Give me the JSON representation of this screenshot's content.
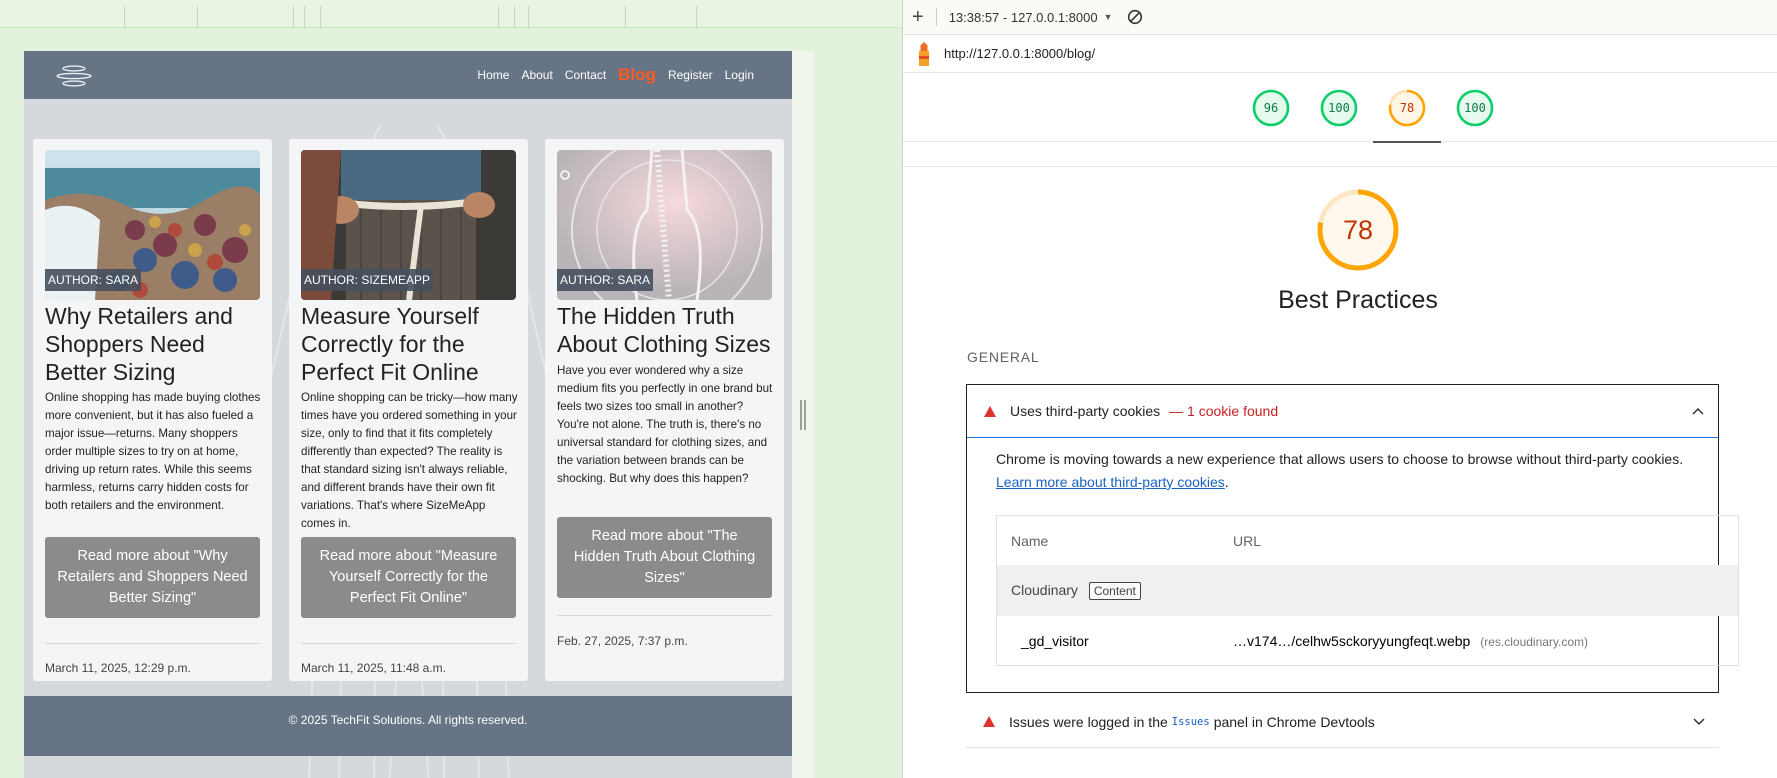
{
  "colors": {
    "pass": "#0cce6b",
    "average": "#ffa400",
    "average_text": "#c33300",
    "fail": "#e03131",
    "nav_bg": "#667486",
    "nav_active": "#ff5a1f",
    "button_bg": "#8b8b8b"
  },
  "site": {
    "logo_icon": "hamburger-ellipse-logo",
    "nav": {
      "home": "Home",
      "about": "About",
      "contact": "Contact",
      "blog": "Blog",
      "register": "Register",
      "login": "Login"
    },
    "posts": [
      {
        "author": "AUTHOR: SARA",
        "title": "Why Retailers and Shoppers Need Better Sizing",
        "excerpt": "Online shopping has made buying clothes more convenient, but it has also fueled a major issue—returns. Many shoppers order multiple sizes to try on at home, driving up return rates. While this seems harmless, returns carry hidden costs for both retailers and the environment.",
        "button": "Read more about \"Why Retailers and Shoppers Need Better Sizing\"",
        "date": "March 11, 2025, 12:29 p.m."
      },
      {
        "author": "AUTHOR: SIZEMEAPP",
        "title": "Measure Yourself Correctly for the Perfect Fit Online",
        "excerpt": "Online shopping can be tricky—how many times have you ordered something in your size, only to find that it fits completely differently than expected? The reality is that standard sizing isn't always reliable, and different brands have their own fit variations. That's where SizeMeApp comes in.",
        "button": "Read more about \"Measure Yourself Correctly for the Perfect Fit Online\"",
        "date": "March 11, 2025, 11:48 a.m."
      },
      {
        "author": "AUTHOR: SARA",
        "title": "The Hidden Truth About Clothing Sizes",
        "excerpt": "Have you ever wondered why a size medium fits you perfectly in one brand but feels two sizes too small in another? You're not alone. The truth is, there's no universal standard for clothing sizes, and the variation between brands can be shocking. But why does this happen?",
        "button": "Read more about \"The Hidden Truth About Clothing Sizes\"",
        "date": "Feb. 27, 2025, 7:37 p.m."
      }
    ],
    "footer": "© 2025 TechFit Solutions. All rights reserved."
  },
  "lighthouse": {
    "report_time": "13:38:57 - 127.0.0.1:8000",
    "url": "http://127.0.0.1:8000/blog/",
    "scores": [
      {
        "value": 96,
        "status": "pass"
      },
      {
        "value": 100,
        "status": "pass"
      },
      {
        "value": 78,
        "status": "average",
        "selected": true
      },
      {
        "value": 100,
        "status": "pass"
      }
    ],
    "category": {
      "score": "78",
      "title": "Best Practices"
    },
    "group": "GENERAL",
    "audit_open": {
      "title": "Uses third-party cookies",
      "display_value": "— 1 cookie found",
      "description": "Chrome is moving towards a new experience that allows users to choose to browse without third-party cookies.",
      "link": "Learn more about third-party cookies",
      "table": {
        "col_name": "Name",
        "col_url": "URL",
        "entity": "Cloudinary",
        "entity_badge": "Content",
        "cookie_name": "_gd_visitor",
        "cookie_url": "…v174…/celhw5sckoryyungfeqt.webp",
        "cookie_origin": "(res.cloudinary.com)"
      }
    },
    "audit_closed": {
      "prefix": "Issues were logged in the",
      "code": "Issues",
      "suffix": "panel in Chrome Devtools"
    }
  }
}
